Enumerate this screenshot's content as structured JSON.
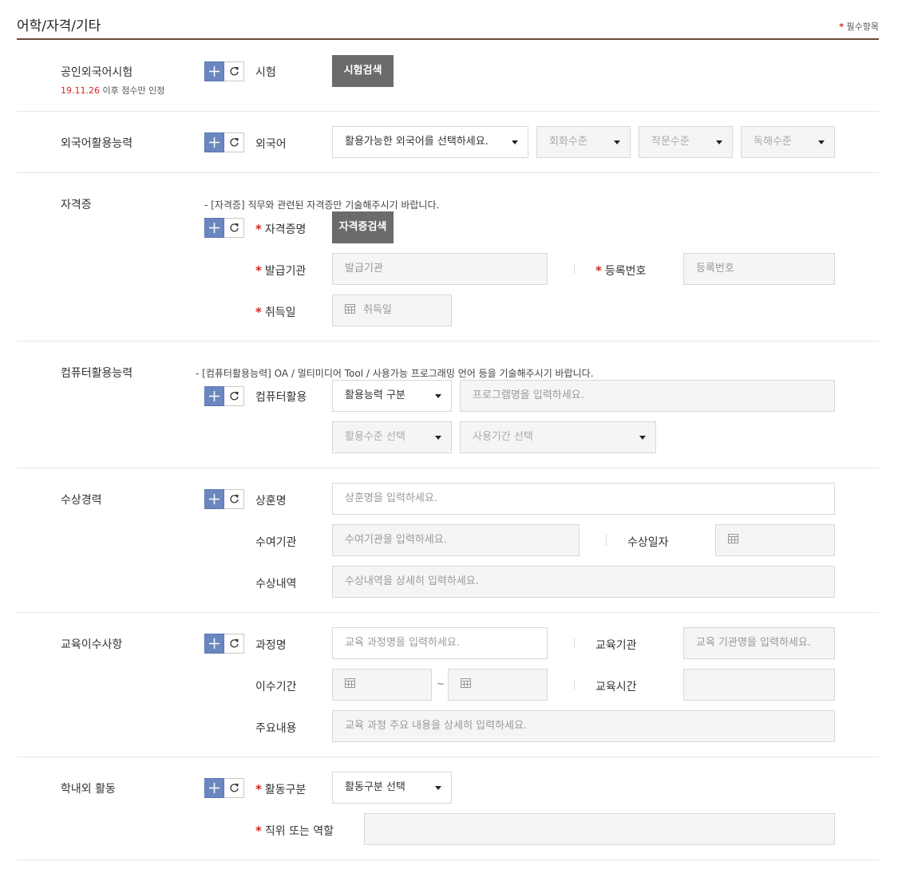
{
  "header": {
    "title": "어학/자격/기타",
    "required_star": "*",
    "required_label": "필수항목"
  },
  "lang_test": {
    "section_label": "공인외국어시험",
    "note_date": "19.11.26",
    "note_text": " 이후 점수만 인정",
    "field_label": "시험",
    "search_button": "시험검색"
  },
  "foreign_lang": {
    "section_label": "외국어활용능력",
    "field_label": "외국어",
    "select_language": "활용가능한 외국어를 선택하세요.",
    "select_conversation": "회화수준",
    "select_writing": "작문수준",
    "select_reading": "독해수준"
  },
  "certificate": {
    "section_label": "자격증",
    "note": "- [자격증] 직무와 관련된 자격증만 기술해주시기 바랍니다.",
    "name_label": "자격증명",
    "search_button": "자격증검색",
    "issuer_label": "발급기관",
    "issuer_placeholder": "발급기관",
    "regno_label": "등록번호",
    "regno_placeholder": "등록번호",
    "date_label": "취득일",
    "date_placeholder": "취득일"
  },
  "computer": {
    "section_label": "컴퓨터활용능력",
    "note": "- [컴퓨터활용능력]  OA / 멀티미디어 Tool / 사용가능 프로그래밍 언어 등을 기술해주시기 바랍니다.",
    "field_label": "컴퓨터활용",
    "select_category": "활용능력 구분",
    "program_placeholder": "프로그램명을 입력하세요.",
    "select_level": "활용수준 선택",
    "select_period": "사용기간 선택"
  },
  "award": {
    "section_label": "수상경력",
    "name_label": "상훈명",
    "name_placeholder": "상훈명을 입력하세요.",
    "org_label": "수여기관",
    "org_placeholder": "수여기관을 입력하세요.",
    "date_label": "수상일자",
    "detail_label": "수상내역",
    "detail_placeholder": "수상내역을 상세히 입력하세요."
  },
  "education": {
    "section_label": "교육이수사항",
    "course_label": "과정명",
    "course_placeholder": "교육 과정명을 입력하세요.",
    "inst_label": "교육기관",
    "inst_placeholder": "교육 기관명을 입력하세요.",
    "period_label": "이수기간",
    "tilde": "~",
    "hours_label": "교육시간",
    "content_label": "주요내용",
    "content_placeholder": "교육 과정 주요 내용을 상세히 입력하세요."
  },
  "activity": {
    "section_label": "학내외 활동",
    "type_label": "활동구분",
    "select_type": "활동구분 선택",
    "role_label": "직위 또는 역할"
  },
  "icons": {
    "add": "plus-icon",
    "reset": "refresh-icon",
    "calendar": "calendar-icon",
    "dropdown": "caret-down-icon"
  },
  "colors": {
    "accent_blue": "#6b87c0",
    "title_rule": "#6b4a3a",
    "required_red": "#d9241c",
    "dark_button": "#6b6b6b"
  }
}
